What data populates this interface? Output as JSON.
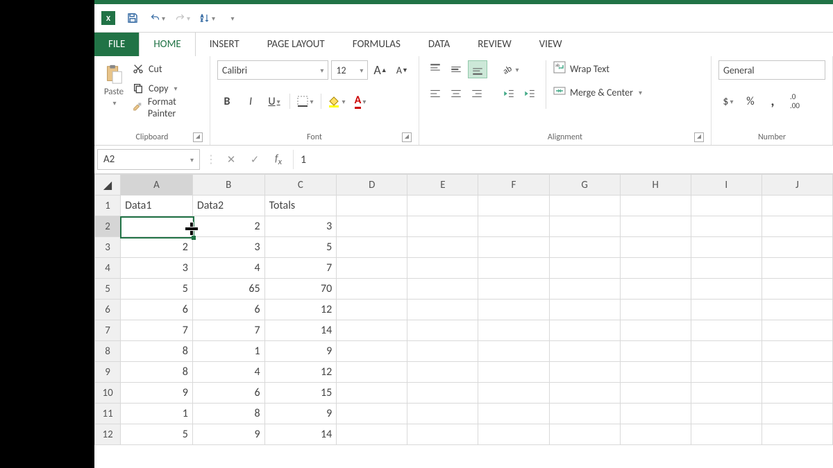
{
  "qat": {
    "xl": "X"
  },
  "tabs": {
    "file": "FILE",
    "home": "HOME",
    "insert": "INSERT",
    "page_layout": "PAGE LAYOUT",
    "formulas": "FORMULAS",
    "data": "DATA",
    "review": "REVIEW",
    "view": "VIEW"
  },
  "ribbon": {
    "clipboard": {
      "paste": "Paste",
      "cut": "Cut",
      "copy": "Copy",
      "format_painter": "Format Painter",
      "label": "Clipboard"
    },
    "font": {
      "name": "Calibri",
      "size": "12",
      "bold": "B",
      "italic": "I",
      "underline": "U",
      "grow": "A",
      "shrink": "A",
      "label": "Font"
    },
    "alignment": {
      "wrap": "Wrap Text",
      "merge": "Merge & Center",
      "label": "Alignment"
    },
    "number": {
      "format": "General",
      "currency": "$",
      "percent": "%",
      "comma": ",",
      "label": "Number"
    }
  },
  "fx": {
    "namebox": "A2",
    "formula": "1"
  },
  "grid": {
    "columns": [
      "A",
      "B",
      "C",
      "D",
      "E",
      "F",
      "G",
      "H",
      "I",
      "J"
    ],
    "rows": [
      {
        "n": "1",
        "cells": [
          "Data1",
          "Data2",
          "Totals",
          "",
          "",
          "",
          "",
          "",
          "",
          ""
        ],
        "txt": [
          0,
          1,
          2
        ]
      },
      {
        "n": "2",
        "cells": [
          "",
          "2",
          "3",
          "",
          "",
          "",
          "",
          "",
          "",
          ""
        ]
      },
      {
        "n": "3",
        "cells": [
          "2",
          "3",
          "5",
          "",
          "",
          "",
          "",
          "",
          "",
          ""
        ]
      },
      {
        "n": "4",
        "cells": [
          "3",
          "4",
          "7",
          "",
          "",
          "",
          "",
          "",
          "",
          ""
        ]
      },
      {
        "n": "5",
        "cells": [
          "5",
          "65",
          "70",
          "",
          "",
          "",
          "",
          "",
          "",
          ""
        ]
      },
      {
        "n": "6",
        "cells": [
          "6",
          "6",
          "12",
          "",
          "",
          "",
          "",
          "",
          "",
          ""
        ]
      },
      {
        "n": "7",
        "cells": [
          "7",
          "7",
          "14",
          "",
          "",
          "",
          "",
          "",
          "",
          ""
        ]
      },
      {
        "n": "8",
        "cells": [
          "8",
          "1",
          "9",
          "",
          "",
          "",
          "",
          "",
          "",
          ""
        ]
      },
      {
        "n": "9",
        "cells": [
          "8",
          "4",
          "12",
          "",
          "",
          "",
          "",
          "",
          "",
          ""
        ]
      },
      {
        "n": "10",
        "cells": [
          "9",
          "6",
          "15",
          "",
          "",
          "",
          "",
          "",
          "",
          ""
        ]
      },
      {
        "n": "11",
        "cells": [
          "1",
          "8",
          "9",
          "",
          "",
          "",
          "",
          "",
          "",
          ""
        ]
      },
      {
        "n": "12",
        "cells": [
          "5",
          "9",
          "14",
          "",
          "",
          "",
          "",
          "",
          "",
          ""
        ]
      }
    ],
    "selected": {
      "row": 2,
      "col": "A"
    }
  }
}
